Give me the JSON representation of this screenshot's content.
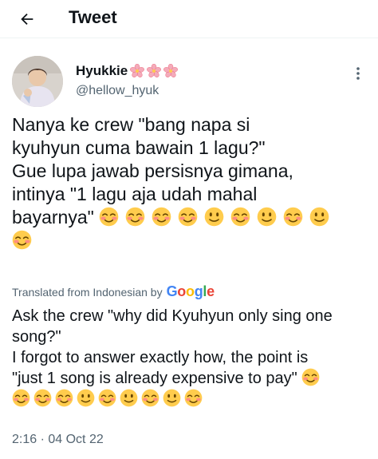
{
  "header": {
    "title": "Tweet",
    "back_icon": "arrow-left-icon"
  },
  "author": {
    "name": "Hyukkie",
    "badges": [
      "cherry-blossom-emoji",
      "cherry-blossom-emoji",
      "cherry-blossom-emoji"
    ],
    "handle": "@hellow_hyuk"
  },
  "tweet": {
    "lines": [
      "Nanya ke crew \"bang napa si",
      "kyuhyun cuma bawain 1 lagu?\"",
      "Gue lupa jawab persisnya gimana,",
      "intinya \"1 lagu aja udah mahal",
      "bayarnya\""
    ],
    "emojis": [
      "smiling-blush",
      "smiling-blush",
      "smiling-blush",
      "smiling-blush",
      "slightly-smiling",
      "smiling-blush",
      "slightly-smiling",
      "smiling-blush",
      "slightly-smiling",
      "smiling-blush"
    ]
  },
  "translation": {
    "label": "Translated from Indonesian by",
    "provider": "Google",
    "provider_colors": [
      "#4285F4",
      "#EA4335",
      "#FBBC05",
      "#4285F4",
      "#34A853",
      "#EA4335"
    ],
    "lines": [
      "Ask the crew \"why did Kyuhyun only sing one",
      "song?\"",
      "I forgot to answer exactly how, the point is",
      "\"just 1 song is already expensive to pay\""
    ],
    "emojis": [
      "smiling-blush",
      "smiling-blush",
      "smiling-blush",
      "smiling-blush",
      "slightly-smiling",
      "smiling-blush",
      "slightly-smiling",
      "smiling-blush",
      "slightly-smiling",
      "smiling-blush"
    ]
  },
  "timestamp": "2:16 · 04 Oct 22"
}
